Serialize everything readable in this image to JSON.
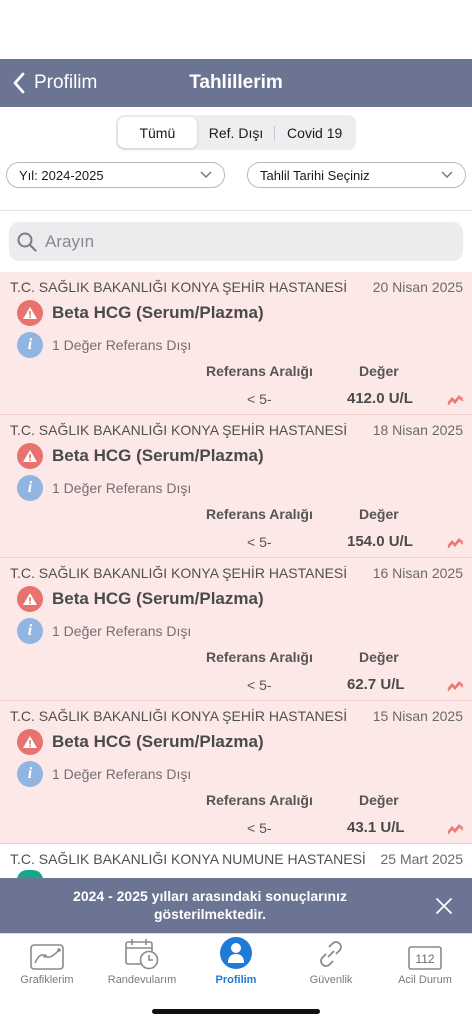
{
  "nav": {
    "back_label": "Profilim",
    "title": "Tahlillerim"
  },
  "segments": [
    {
      "label": "Tümü",
      "active": true
    },
    {
      "label": "Ref. Dışı",
      "active": false
    },
    {
      "label": "Covid 19",
      "active": false
    }
  ],
  "filters": {
    "year": "Yıl: 2024-2025",
    "date": "Tahlil Tarihi Seçiniz"
  },
  "search": {
    "placeholder": "Arayın"
  },
  "results": [
    {
      "hospital": "T.C. SAĞLIK BAKANLIĞI KONYA ŞEHİR HASTANESİ",
      "date": "20 Nisan 2025",
      "test": "Beta HCG (Serum/Plazma)",
      "out_of_range": "1 Değer Referans Dışı",
      "ref_header": "Referans Aralığı",
      "value_header": "Değer",
      "ref": "< 5-",
      "value": "412.0 U/L"
    },
    {
      "hospital": "T.C. SAĞLIK BAKANLIĞI KONYA ŞEHİR HASTANESİ",
      "date": "18 Nisan 2025",
      "test": "Beta HCG (Serum/Plazma)",
      "out_of_range": "1 Değer Referans Dışı",
      "ref_header": "Referans Aralığı",
      "value_header": "Değer",
      "ref": "< 5-",
      "value": "154.0 U/L"
    },
    {
      "hospital": "T.C. SAĞLIK BAKANLIĞI KONYA ŞEHİR HASTANESİ",
      "date": "16 Nisan 2025",
      "test": "Beta HCG (Serum/Plazma)",
      "out_of_range": "1 Değer Referans Dışı",
      "ref_header": "Referans Aralığı",
      "value_header": "Değer",
      "ref": "< 5-",
      "value": "62.7 U/L"
    },
    {
      "hospital": "T.C. SAĞLIK BAKANLIĞI KONYA ŞEHİR HASTANESİ",
      "date": "15 Nisan 2025",
      "test": "Beta HCG (Serum/Plazma)",
      "out_of_range": "1 Değer Referans Dışı",
      "ref_header": "Referans Aralığı",
      "value_header": "Değer",
      "ref": "< 5-",
      "value": "43.1 U/L"
    },
    {
      "hospital": "T.C. SAĞLIK BAKANLIĞI KONYA NUMUNE HASTANESİ",
      "date": "25 Mart 2025"
    }
  ],
  "banner": {
    "text": "2024 - 2025 yılları arasındaki sonuçlarınız gösterilmektedir."
  },
  "tabs": [
    {
      "label": "Grafiklerim",
      "icon": "chart-icon"
    },
    {
      "label": "Randevularım",
      "icon": "calendar-clock-icon"
    },
    {
      "label": "Profilim",
      "icon": "person-icon",
      "active": true
    },
    {
      "label": "Güvenlik",
      "icon": "link-icon"
    },
    {
      "label": "Acil Durum",
      "icon": "emergency-112-icon",
      "badge": "112"
    }
  ],
  "colors": {
    "nav": "#6b7493",
    "card_bg": "#fde8e8",
    "warning": "#e8726f",
    "info": "#8fb5e0",
    "active_tab": "#1e7bd6"
  }
}
